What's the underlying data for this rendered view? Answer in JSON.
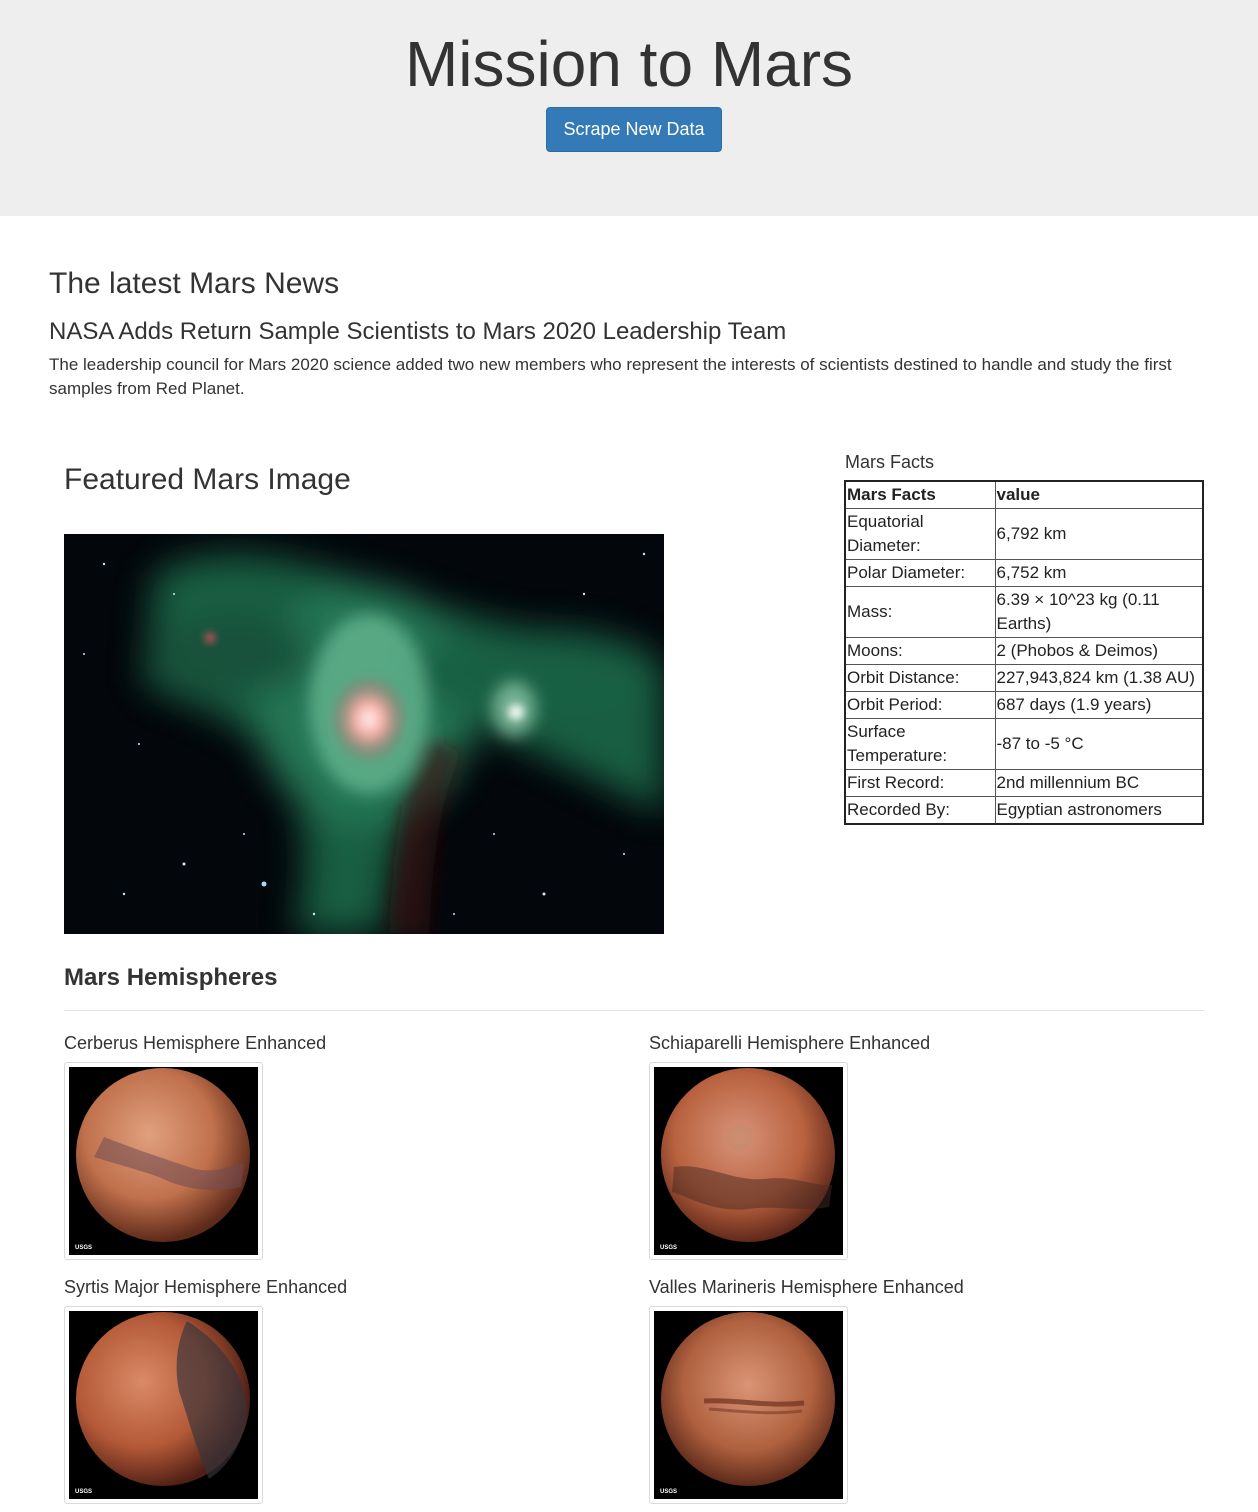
{
  "header": {
    "title": "Mission to Mars",
    "scrape_button_label": "Scrape New Data"
  },
  "news": {
    "heading": "The latest Mars News",
    "title": "NASA Adds Return Sample Scientists to Mars 2020 Leadership Team",
    "teaser": "The leadership council for Mars 2020 science added two new members who represent the interests of scientists destined to handle and study the first samples from Red Planet."
  },
  "featured": {
    "heading": "Featured Mars Image",
    "image_subject": "nebula-image"
  },
  "facts": {
    "caption": "Mars Facts",
    "columns": [
      "Mars Facts",
      "value"
    ],
    "rows": [
      {
        "label": "Equatorial Diameter:",
        "value": "6,792 km"
      },
      {
        "label": "Polar Diameter:",
        "value": "6,752 km"
      },
      {
        "label": "Mass:",
        "value": "6.39 × 10^23 kg (0.11 Earths)"
      },
      {
        "label": "Moons:",
        "value": "2 (Phobos & Deimos)"
      },
      {
        "label": "Orbit Distance:",
        "value": "227,943,824 km (1.38 AU)"
      },
      {
        "label": "Orbit Period:",
        "value": "687 days (1.9 years)"
      },
      {
        "label": "Surface Temperature:",
        "value": "-87 to -5 °C"
      },
      {
        "label": "First Record:",
        "value": "2nd millennium BC"
      },
      {
        "label": "Recorded By:",
        "value": "Egyptian astronomers"
      }
    ]
  },
  "hemispheres": {
    "heading": "Mars Hemispheres",
    "items": [
      {
        "title": "Cerberus Hemisphere Enhanced",
        "logo": "USGS"
      },
      {
        "title": "Schiaparelli Hemisphere Enhanced",
        "logo": "USGS"
      },
      {
        "title": "Syrtis Major Hemisphere Enhanced",
        "logo": "USGS"
      },
      {
        "title": "Valles Marineris Hemisphere Enhanced",
        "logo": "USGS"
      }
    ]
  },
  "colors": {
    "jumbotron_bg": "#eeeeee",
    "button_primary": "#337ab7",
    "text": "#333333",
    "mars_surface": "#b8623f"
  }
}
